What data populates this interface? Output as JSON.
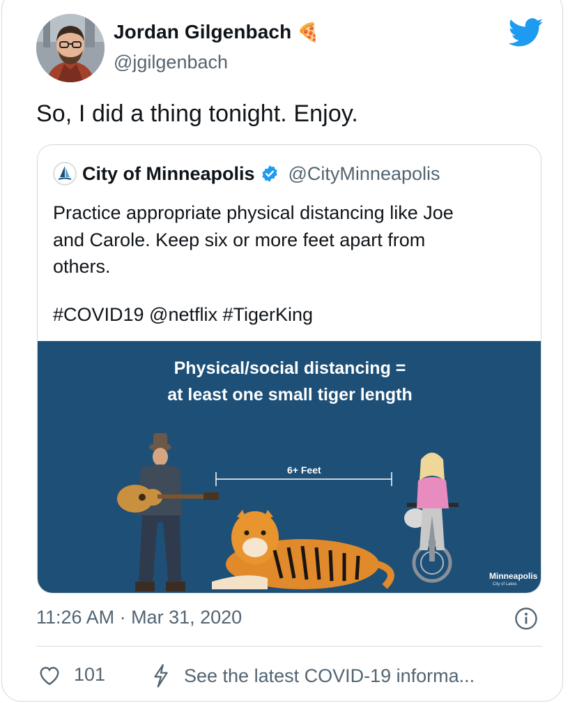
{
  "tweet": {
    "author_name": "Jordan Gilgenbach",
    "author_emoji": "🍕",
    "author_handle": "@jgilgenbach",
    "text": "So, I did a thing tonight. Enjoy.",
    "timestamp": "11:26 AM · Mar 31, 2020",
    "like_count": "101",
    "covid_link": "See the latest COVID-19 informa..."
  },
  "quoted_tweet": {
    "author_name": "City of Minneapolis",
    "author_handle": "@CityMinneapolis",
    "text": "Practice appropriate physical distancing like Joe\nand Carole. Keep six or more feet apart from\nothers.",
    "hashtags": "#COVID19 @netflix #TigerKing",
    "media": {
      "title_line1": "Physical/social distancing =",
      "title_line2": "at least one small tiger length",
      "distance_label": "6+ Feet",
      "logo_text": "Minneapolis",
      "logo_subtext": "City of Lakes",
      "background_color": "#1d4f77"
    }
  },
  "colors": {
    "twitter_blue": "#1d9bf0",
    "secondary_text": "#536471",
    "border": "#cfd9de"
  },
  "icons": [
    "twitter-bird-icon",
    "verified-badge-icon",
    "heart-icon",
    "lightning-icon",
    "info-icon"
  ]
}
